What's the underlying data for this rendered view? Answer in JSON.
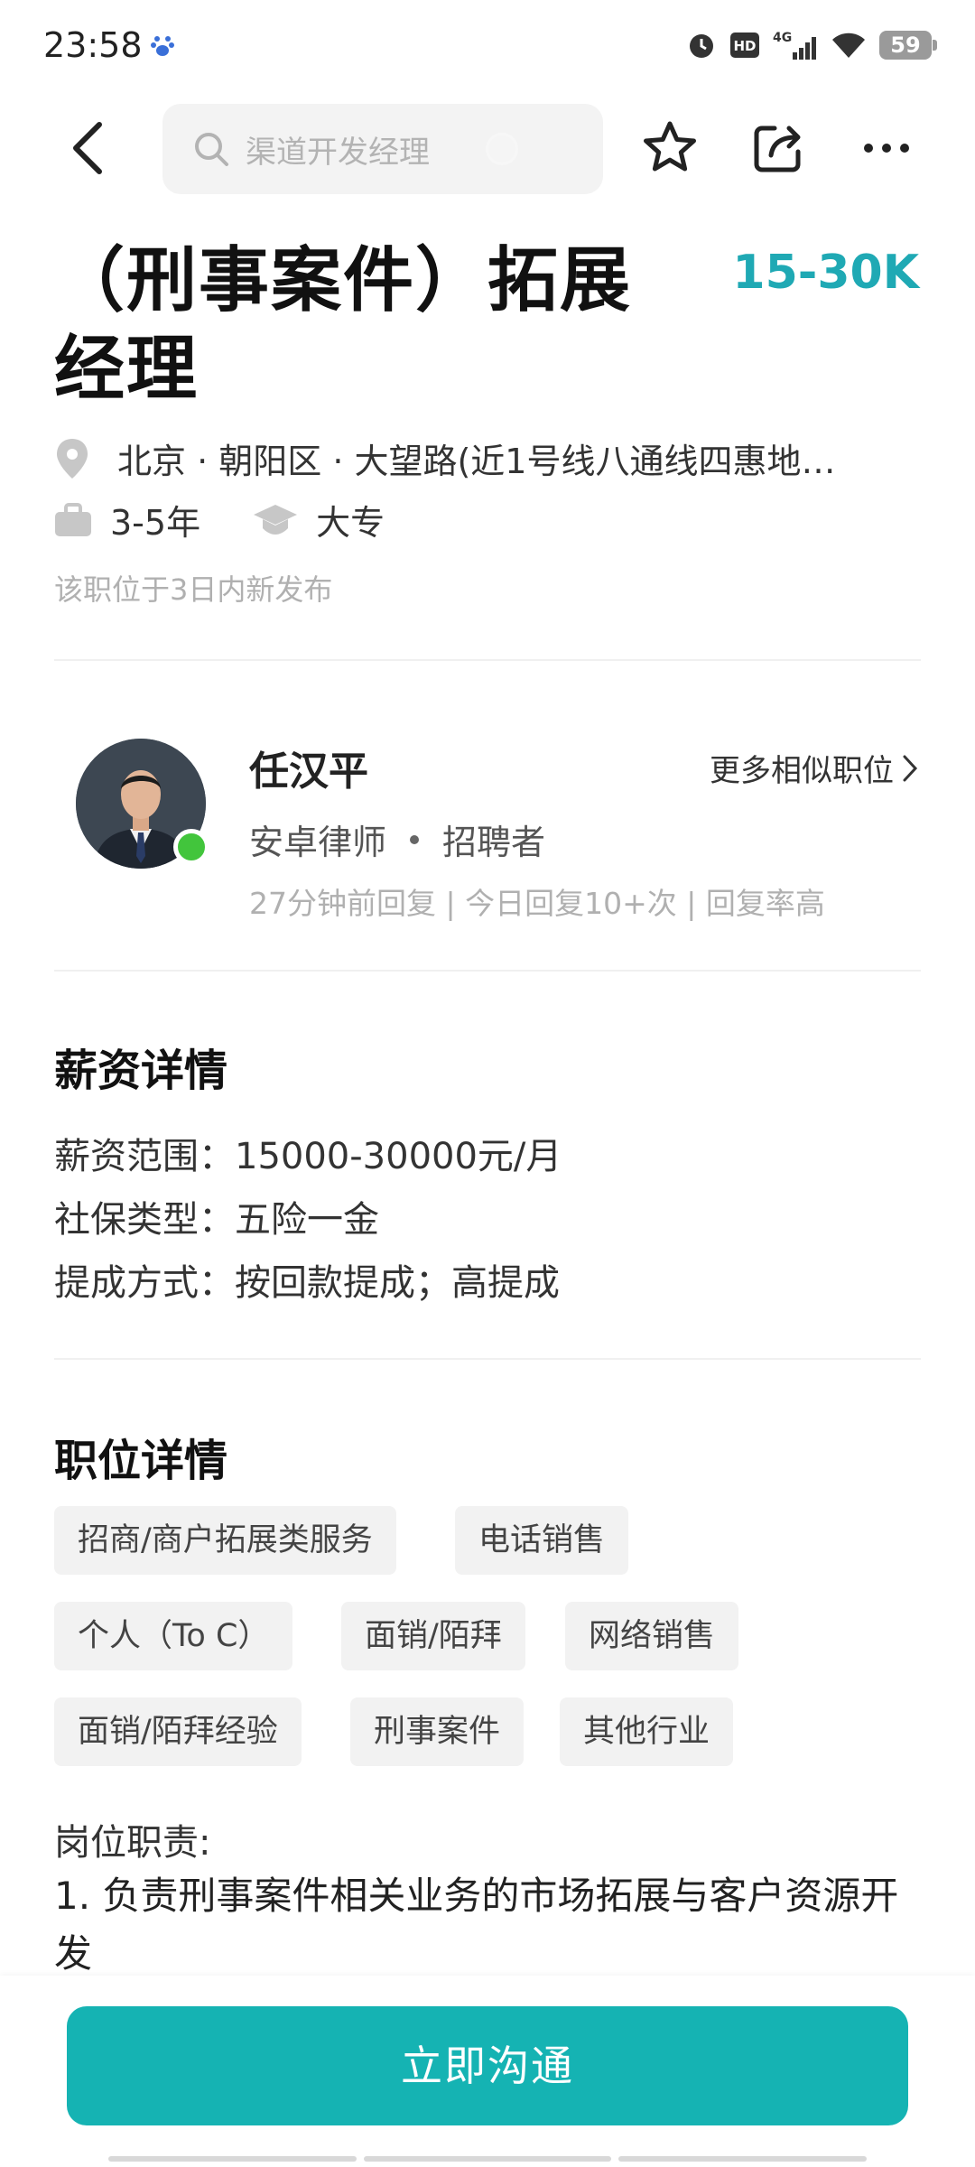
{
  "status_bar": {
    "time": "23:58",
    "network": "4G",
    "hd": "HD",
    "battery": "59"
  },
  "nav": {
    "search_placeholder": "渠道开发经理"
  },
  "job": {
    "title": "（刑事案件）拓展经理",
    "salary": "15-30K",
    "location": "北京 · 朝阳区 · 大望路(近1号线八通线四惠地…",
    "experience": "3-5年",
    "education": "大专",
    "posted": "该职位于3日内新发布"
  },
  "recruiter": {
    "name": "任汉平",
    "more_jobs_label": "更多相似职位",
    "company": "安卓律师",
    "role": "招聘者",
    "stats": "27分钟前回复 | 今日回复10+次 | 回复率高"
  },
  "salary_details": {
    "title": "薪资详情",
    "lines": [
      "薪资范围：15000-30000元/月",
      "社保类型：五险一金",
      "提成方式：按回款提成；高提成"
    ]
  },
  "position_details": {
    "title": "职位详情",
    "tags": [
      "招商/商户拓展类服务",
      "电话销售",
      "个人（To C）",
      "面销/陌拜",
      "网络销售",
      "面销/陌拜经验",
      "刑事案件",
      "其他行业"
    ],
    "duty_label": "岗位职责:",
    "duty_text": "1. 负责刑事案件相关业务的市场拓展与客户资源开发"
  },
  "bottom": {
    "chat_button": "立即沟通"
  },
  "colors": {
    "accent": "#15b3b3",
    "salary": "#1fa9b4",
    "online": "#42c53c"
  }
}
